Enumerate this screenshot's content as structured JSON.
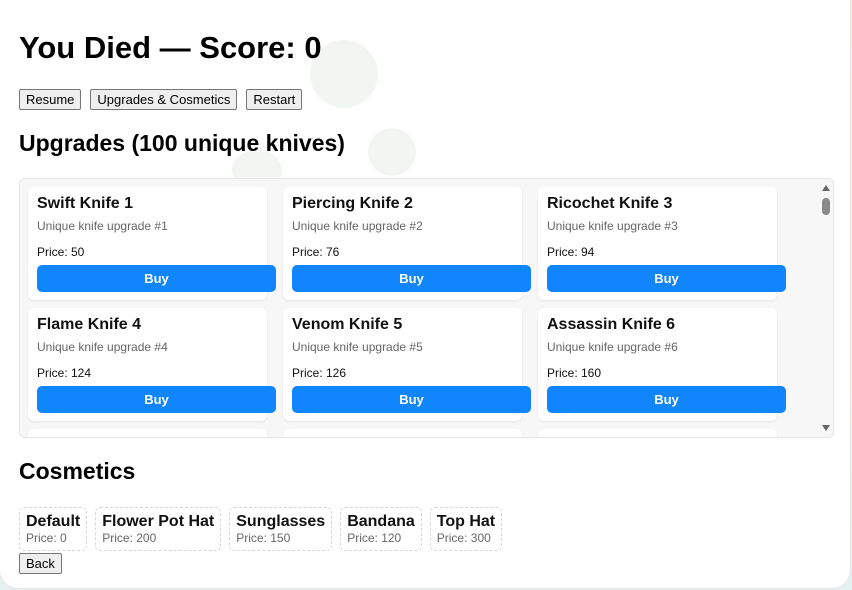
{
  "title": "You Died — Score: 0",
  "top_buttons": {
    "resume": "Resume",
    "upgrades": "Upgrades & Cosmetics",
    "restart": "Restart"
  },
  "upgrades": {
    "heading": "Upgrades (100 unique knives)",
    "buy_label": "Buy",
    "items": [
      {
        "name": "Swift Knife 1",
        "desc": "Unique knife upgrade #1",
        "price": "Price: 50"
      },
      {
        "name": "Piercing Knife 2",
        "desc": "Unique knife upgrade #2",
        "price": "Price: 76"
      },
      {
        "name": "Ricochet Knife 3",
        "desc": "Unique knife upgrade #3",
        "price": "Price: 94"
      },
      {
        "name": "Flame Knife 4",
        "desc": "Unique knife upgrade #4",
        "price": "Price: 124"
      },
      {
        "name": "Venom Knife 5",
        "desc": "Unique knife upgrade #5",
        "price": "Price: 126"
      },
      {
        "name": "Assassin Knife 6",
        "desc": "Unique knife upgrade #6",
        "price": "Price: 160"
      }
    ]
  },
  "cosmetics": {
    "heading": "Cosmetics",
    "items": [
      {
        "name": "Default",
        "price": "Price: 0"
      },
      {
        "name": "Flower Pot Hat",
        "price": "Price: 200"
      },
      {
        "name": "Sunglasses",
        "price": "Price: 150"
      },
      {
        "name": "Bandana",
        "price": "Price: 120"
      },
      {
        "name": "Top Hat",
        "price": "Price: 300"
      }
    ]
  },
  "back_label": "Back",
  "colors": {
    "buy_button": "#1185fc",
    "panel": "#ffffff"
  }
}
